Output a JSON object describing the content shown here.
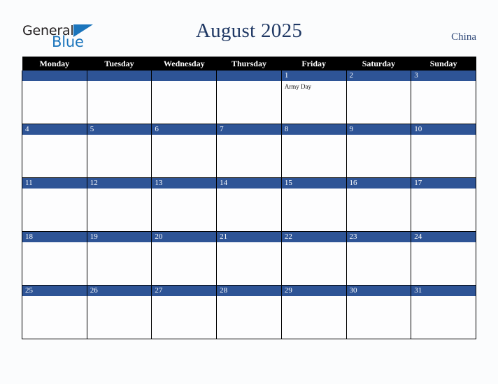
{
  "brand": {
    "name_part1": "General",
    "name_part2": "Blue",
    "triangle_color": "#1b75bc"
  },
  "header": {
    "title": "August 2025",
    "country": "China"
  },
  "theme": {
    "header_bar_color": "#000000",
    "day_number_bar_color": "#2e5496",
    "title_color": "#1f3864",
    "page_background": "#fbfcfd"
  },
  "weekdays": [
    "Monday",
    "Tuesday",
    "Wednesday",
    "Thursday",
    "Friday",
    "Saturday",
    "Sunday"
  ],
  "weeks": [
    [
      {
        "day": "",
        "events": []
      },
      {
        "day": "",
        "events": []
      },
      {
        "day": "",
        "events": []
      },
      {
        "day": "",
        "events": []
      },
      {
        "day": "1",
        "events": [
          "Army Day"
        ]
      },
      {
        "day": "2",
        "events": []
      },
      {
        "day": "3",
        "events": []
      }
    ],
    [
      {
        "day": "4",
        "events": []
      },
      {
        "day": "5",
        "events": []
      },
      {
        "day": "6",
        "events": []
      },
      {
        "day": "7",
        "events": []
      },
      {
        "day": "8",
        "events": []
      },
      {
        "day": "9",
        "events": []
      },
      {
        "day": "10",
        "events": []
      }
    ],
    [
      {
        "day": "11",
        "events": []
      },
      {
        "day": "12",
        "events": []
      },
      {
        "day": "13",
        "events": []
      },
      {
        "day": "14",
        "events": []
      },
      {
        "day": "15",
        "events": []
      },
      {
        "day": "16",
        "events": []
      },
      {
        "day": "17",
        "events": []
      }
    ],
    [
      {
        "day": "18",
        "events": []
      },
      {
        "day": "19",
        "events": []
      },
      {
        "day": "20",
        "events": []
      },
      {
        "day": "21",
        "events": []
      },
      {
        "day": "22",
        "events": []
      },
      {
        "day": "23",
        "events": []
      },
      {
        "day": "24",
        "events": []
      }
    ],
    [
      {
        "day": "25",
        "events": []
      },
      {
        "day": "26",
        "events": []
      },
      {
        "day": "27",
        "events": []
      },
      {
        "day": "28",
        "events": []
      },
      {
        "day": "29",
        "events": []
      },
      {
        "day": "30",
        "events": []
      },
      {
        "day": "31",
        "events": []
      }
    ]
  ]
}
